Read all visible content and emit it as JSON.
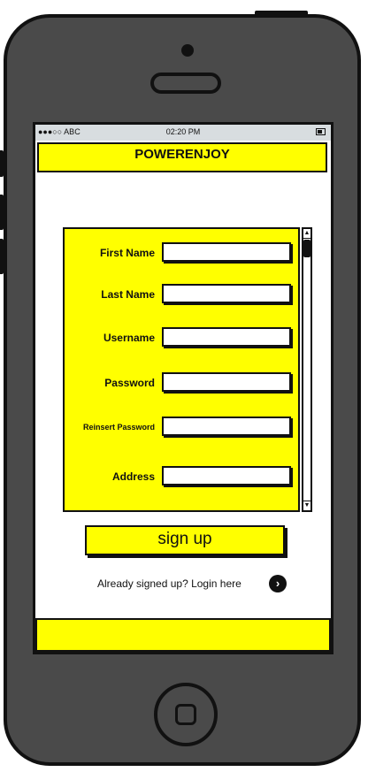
{
  "status_bar": {
    "carrier": "●●●○○ ABC",
    "time": "02:20 PM"
  },
  "header": {
    "title": "POWERENJOY"
  },
  "form": {
    "fields": [
      {
        "label": "First Name",
        "value": ""
      },
      {
        "label": "Last Name",
        "value": ""
      },
      {
        "label": "Username",
        "value": ""
      },
      {
        "label": "Password",
        "value": ""
      },
      {
        "label": "Reinsert Password",
        "value": ""
      },
      {
        "label": "Address",
        "value": ""
      }
    ]
  },
  "actions": {
    "signup_label": "sign up",
    "login_text": "Already signed up? Login here",
    "login_arrow": "›"
  },
  "scrollbar": {
    "up": "▲",
    "down": "▼"
  },
  "colors": {
    "accent": "#ffff00",
    "phone_body": "#4a4a4a",
    "outline": "#111111"
  }
}
